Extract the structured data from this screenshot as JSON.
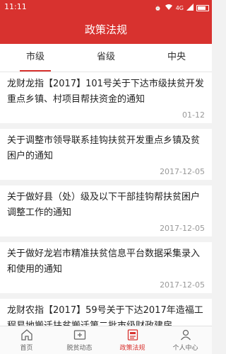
{
  "status": {
    "time": "11:11",
    "network": "4G"
  },
  "header": {
    "title": "政策法规"
  },
  "tabs": [
    {
      "label": "市级",
      "active": true
    },
    {
      "label": "省级",
      "active": false
    },
    {
      "label": "中央",
      "active": false
    }
  ],
  "items": [
    {
      "title": "龙财龙指【2017】101号关于下达市级扶贫开发重点乡镇、村项目帮扶资金的通知",
      "date": "01-12"
    },
    {
      "title": "关于调整市领导联系挂钩扶贫开发重点乡镇及贫困户的通知",
      "date": "2017-12-05"
    },
    {
      "title": "关于做好县（处）级及以下干部挂钩帮扶贫困户调整工作的通知",
      "date": "2017-12-05"
    },
    {
      "title": "关于做好龙岩市精准扶贫信息平台数据采集录入和使用的通知",
      "date": "2017-12-05"
    },
    {
      "title": "龙财农指【2017】59号关于下达2017年造福工程易地搬迁扶贫搬迁第二批市级财政建房...",
      "date": ""
    }
  ],
  "nav": [
    {
      "label": "首页",
      "icon": "home-icon",
      "active": false
    },
    {
      "label": "脱贫动态",
      "icon": "news-icon",
      "active": false
    },
    {
      "label": "政策法规",
      "icon": "policy-icon",
      "active": true
    },
    {
      "label": "个人中心",
      "icon": "person-icon",
      "active": false
    }
  ],
  "colors": {
    "accent": "#d8322f",
    "background": "#f2f2f2"
  }
}
